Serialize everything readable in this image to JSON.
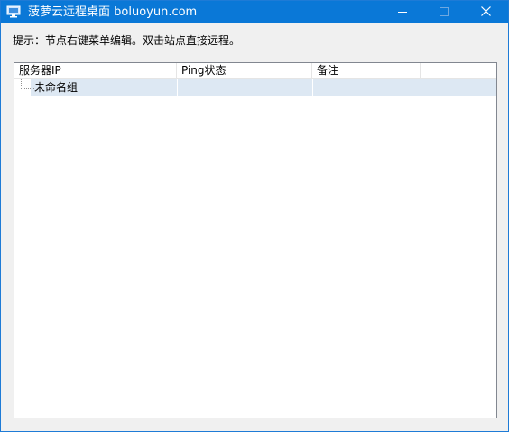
{
  "window": {
    "title": "菠萝云远程桌面 boluoyun.com",
    "icon": "monitor-icon",
    "accent_color": "#0a78d7",
    "controls": [
      "minimize-icon",
      "maximize-icon",
      "close-icon"
    ]
  },
  "hint": "提示：节点右键菜单编辑。双击站点直接远程。",
  "tree": {
    "columns": [
      "服务器IP",
      "Ping状态",
      "备注",
      ""
    ],
    "rows": [
      {
        "name": "未命名组",
        "ping": "",
        "note": "",
        "extra": ""
      }
    ],
    "selected_row_color": "#dde8f3"
  }
}
